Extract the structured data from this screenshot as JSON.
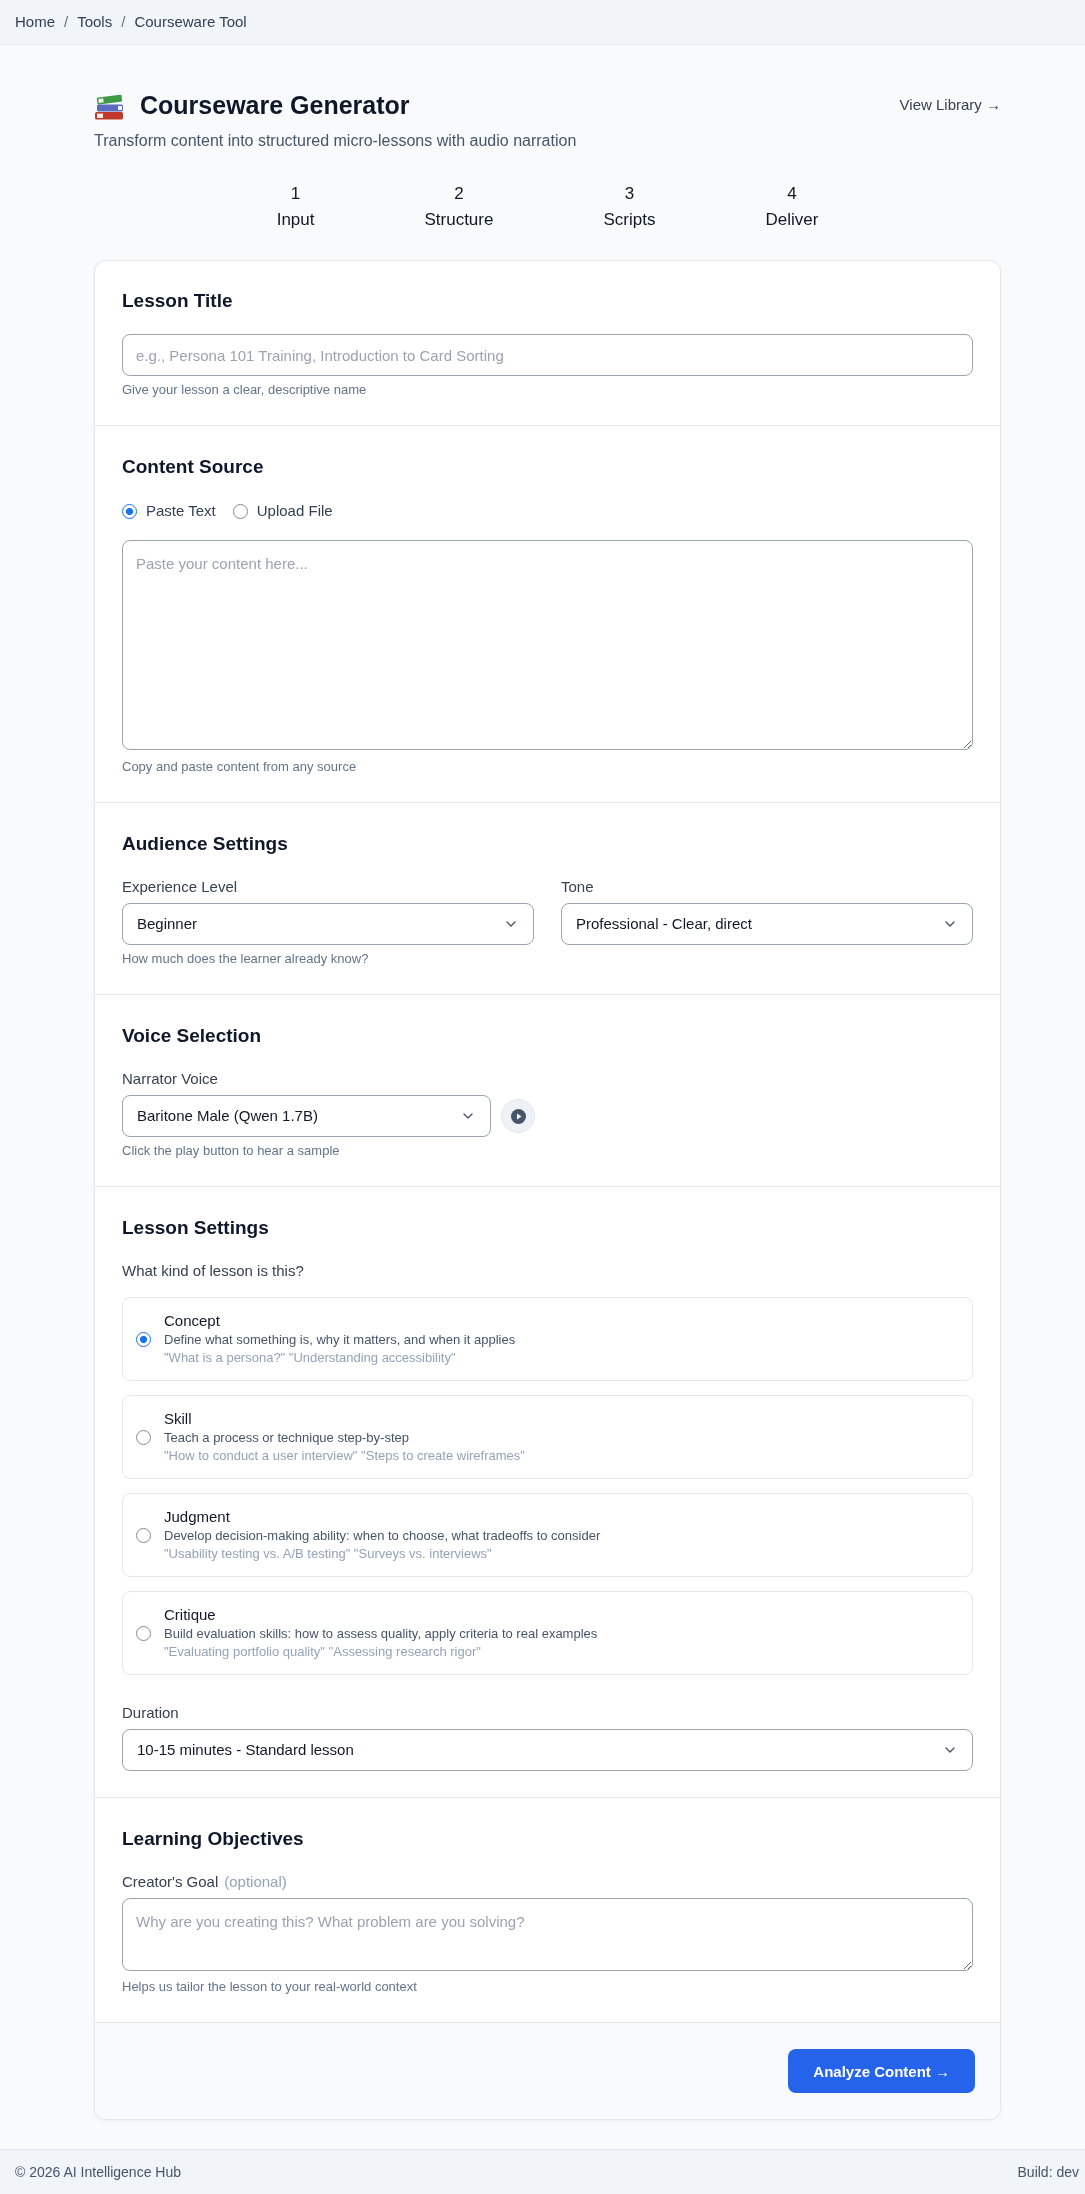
{
  "breadcrumb": {
    "items": [
      {
        "label": "Home"
      },
      {
        "label": "Tools"
      },
      {
        "label": "Courseware Tool"
      }
    ],
    "separator": "/"
  },
  "header": {
    "title": "Courseware Generator",
    "subtitle": "Transform content into structured micro-lessons with audio narration",
    "link": "View Library →"
  },
  "steps": [
    {
      "number": "1",
      "label": "Input"
    },
    {
      "number": "2",
      "label": "Structure"
    },
    {
      "number": "3",
      "label": "Scripts"
    },
    {
      "number": "4",
      "label": "Deliver"
    }
  ],
  "lesson_title": {
    "heading": "Lesson Title",
    "placeholder": "e.g., Persona 101 Training, Introduction to Card Sorting",
    "help": "Give your lesson a clear, descriptive name"
  },
  "content_source": {
    "heading": "Content Source",
    "options": [
      {
        "label": "Paste Text",
        "selected": true
      },
      {
        "label": "Upload File",
        "selected": false
      }
    ],
    "placeholder": "Paste your content here...",
    "help": "Copy and paste content from any source"
  },
  "audience_settings": {
    "heading": "Audience Settings",
    "fields": [
      {
        "label": "Experience Level",
        "value": "Beginner",
        "help": "How much does the learner already know?"
      },
      {
        "label": "Tone",
        "value": "Professional - Clear, direct"
      }
    ]
  },
  "voice_selection": {
    "heading": "Voice Selection",
    "label": "Narrator Voice",
    "value": "Baritone Male (Qwen 1.7B)",
    "help": "Click the play button to hear a sample"
  },
  "lesson_settings": {
    "heading": "Lesson Settings",
    "question": "What kind of lesson is this?",
    "lesson_types": [
      {
        "title": "Concept",
        "description": "Define what something is, why it matters, and when it applies",
        "examples": "\"What is a persona?\" \"Understanding accessibility\"",
        "selected": true
      },
      {
        "title": "Skill",
        "description": "Teach a process or technique step-by-step",
        "examples": "\"How to conduct a user interview\" \"Steps to create wireframes\"",
        "selected": false
      },
      {
        "title": "Judgment",
        "description": "Develop decision-making ability: when to choose, what tradeoffs to consider",
        "examples": "\"Usability testing vs. A/B testing\" \"Surveys vs. interviews\"",
        "selected": false
      },
      {
        "title": "Critique",
        "description": "Build evaluation skills: how to assess quality, apply criteria to real examples",
        "examples": "\"Evaluating portfolio quality\" \"Assessing research rigor\"",
        "selected": false
      }
    ],
    "duration": {
      "label": "Duration",
      "value": "10-15 minutes - Standard lesson"
    }
  },
  "learning_objectives": {
    "heading": "Learning Objectives",
    "label": "Creator's Goal",
    "label_note": "(optional)",
    "placeholder": "Why are you creating this? What problem are you solving?",
    "help": "Helps us tailor the lesson to your real-world context"
  },
  "submit_button": "Analyze Content →",
  "footer": {
    "copyright": "© 2026 AI Intelligence Hub",
    "build": "Build: dev"
  }
}
